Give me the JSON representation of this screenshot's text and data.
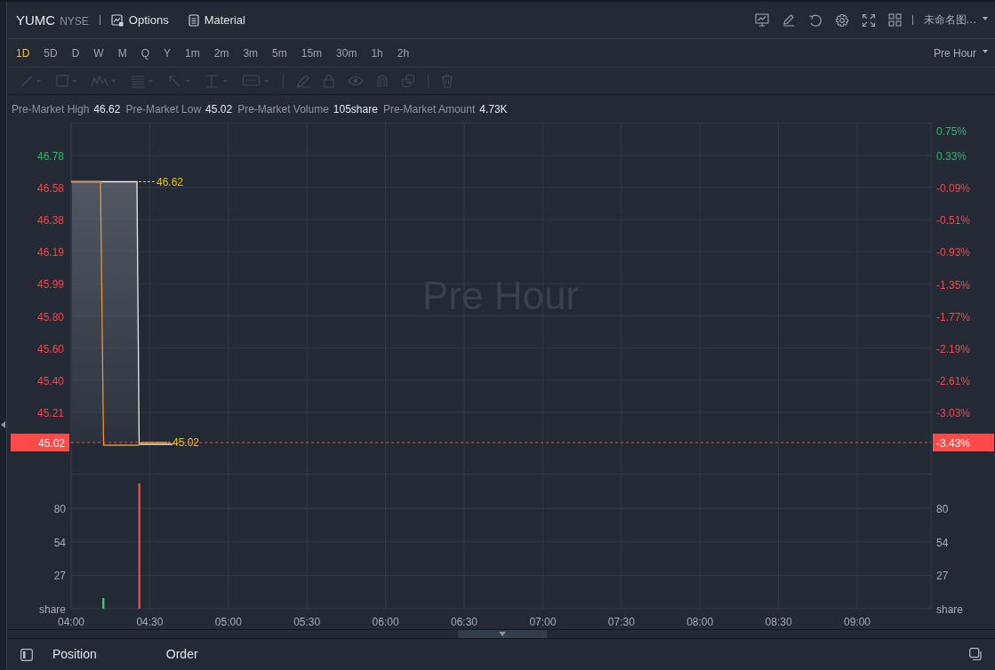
{
  "header": {
    "symbol": "YUMC",
    "exchange": "NYSE",
    "links": [
      {
        "label": "Options",
        "kind": "options"
      },
      {
        "label": "Material",
        "kind": "material"
      }
    ],
    "layout_name": "未命名图..."
  },
  "timeframes": [
    {
      "label": "1D",
      "selected": true
    },
    {
      "label": "5D",
      "selected": false
    },
    {
      "label": "D",
      "selected": false
    },
    {
      "label": "W",
      "selected": false
    },
    {
      "label": "M",
      "selected": false
    },
    {
      "label": "Q",
      "selected": false
    },
    {
      "label": "Y",
      "selected": false
    },
    {
      "label": "1m",
      "selected": false
    },
    {
      "label": "2m",
      "selected": false
    },
    {
      "label": "3m",
      "selected": false
    },
    {
      "label": "5m",
      "selected": false
    },
    {
      "label": "15m",
      "selected": false
    },
    {
      "label": "30m",
      "selected": false
    },
    {
      "label": "1h",
      "selected": false
    },
    {
      "label": "2h",
      "selected": false
    }
  ],
  "session": "Pre Hour",
  "drawing_toolbar": {
    "disabled": true
  },
  "stats": [
    {
      "label": "Pre-Market High",
      "value": "46.62"
    },
    {
      "label": "Pre-Market Low",
      "value": "45.02"
    },
    {
      "label": "Pre-Market Volume",
      "value": "105share"
    },
    {
      "label": "Pre-Market Amount",
      "value": "4.73K"
    }
  ],
  "watermark_label": "Pre Hour",
  "price_chart": {
    "price_ticks": [
      "46.78",
      "46.58",
      "46.38",
      "46.19",
      "45.99",
      "45.80",
      "45.60",
      "45.40",
      "45.21"
    ],
    "high_marker": "46.62",
    "low_marker": "45.02",
    "percent_axis": [
      {
        "label": "0.75%",
        "color": "#2fb86a"
      },
      {
        "label": "0.33%",
        "color": "#2fb86a"
      },
      {
        "label": "-0.09%",
        "color": "#f04848"
      },
      {
        "label": "-0.51%",
        "color": "#f04848"
      },
      {
        "label": "-0.93%",
        "color": "#f04848"
      },
      {
        "label": "-1.35%",
        "color": "#f04848"
      },
      {
        "label": "-1.77%",
        "color": "#f04848"
      },
      {
        "label": "-2.19%",
        "color": "#f04848"
      },
      {
        "label": "-2.61%",
        "color": "#f04848"
      },
      {
        "label": "-3.03%",
        "color": "#f04848"
      }
    ],
    "last_price": {
      "price": "45.02",
      "change": "-3.43%"
    }
  },
  "volume_chart": {
    "left_ticks": [
      "80",
      "54",
      "27",
      "share"
    ],
    "right_ticks": [
      "80",
      "54",
      "27",
      "share"
    ]
  },
  "time_axis": [
    "04:00",
    "04:30",
    "05:00",
    "05:30",
    "06:00",
    "06:30",
    "07:00",
    "07:30",
    "08:00",
    "08:30",
    "09:00"
  ],
  "bottom_tabs": [
    {
      "label": "Position",
      "selected": false
    },
    {
      "label": "Order",
      "selected": false
    }
  ]
}
